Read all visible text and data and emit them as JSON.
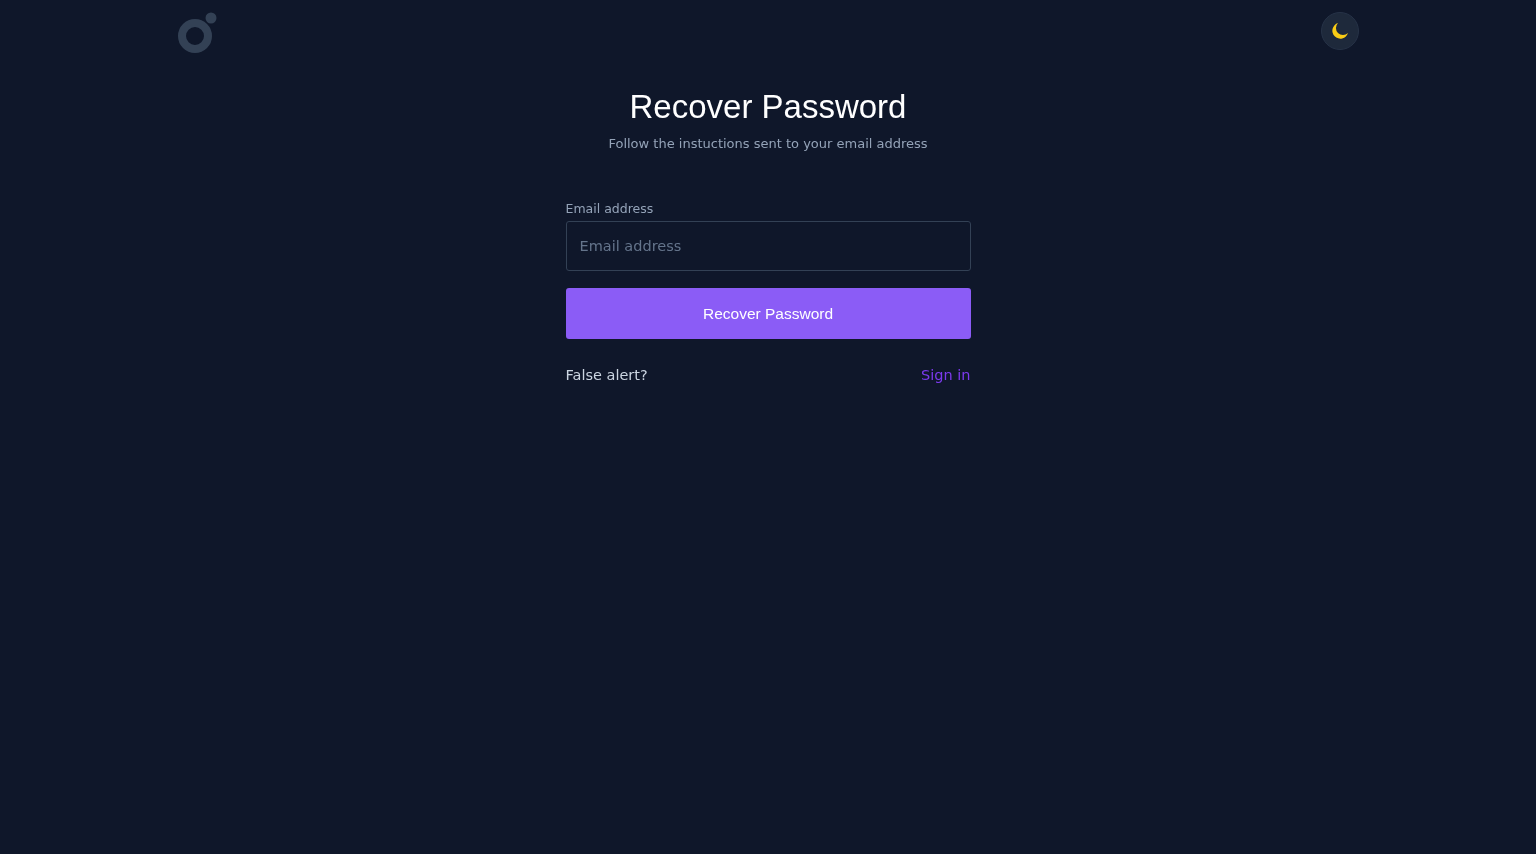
{
  "title": "Recover Password",
  "subtitle": "Follow the instuctions sent to your email address",
  "email_field": {
    "label": "Email address",
    "placeholder": "Email address"
  },
  "submit_button": "Recover Password",
  "footer": {
    "prompt": "False alert?",
    "link": "Sign in"
  }
}
